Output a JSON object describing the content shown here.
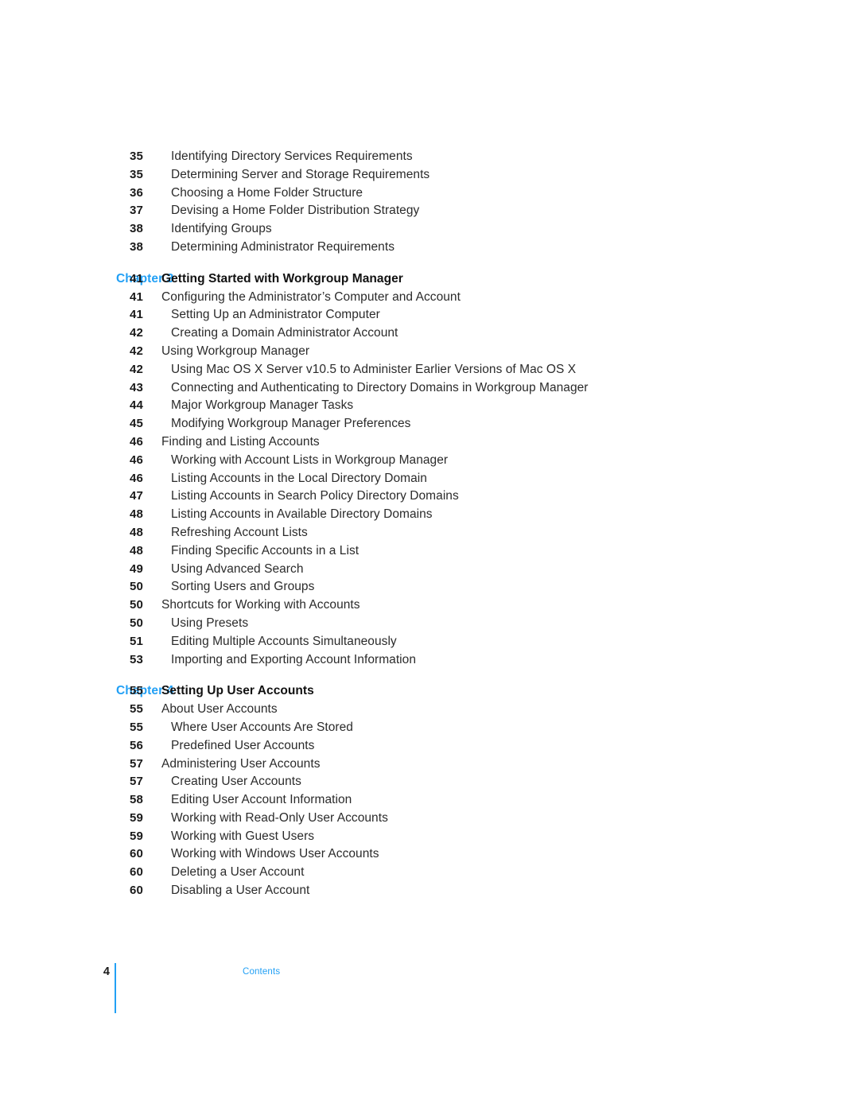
{
  "footer": {
    "page_number": "4",
    "label": "Contents",
    "rule_color": "#22a0f5"
  },
  "accent_color": "#22a0f5",
  "toc": {
    "rows": [
      {
        "chapter": "",
        "page": "35",
        "title": "Identifying Directory Services Requirements",
        "level": 2,
        "gap_before": false
      },
      {
        "chapter": "",
        "page": "35",
        "title": "Determining Server and Storage Requirements",
        "level": 2,
        "gap_before": false
      },
      {
        "chapter": "",
        "page": "36",
        "title": "Choosing a Home Folder Structure",
        "level": 2,
        "gap_before": false
      },
      {
        "chapter": "",
        "page": "37",
        "title": "Devising a Home Folder Distribution Strategy",
        "level": 2,
        "gap_before": false
      },
      {
        "chapter": "",
        "page": "38",
        "title": "Identifying Groups",
        "level": 2,
        "gap_before": false
      },
      {
        "chapter": "",
        "page": "38",
        "title": "Determining Administrator Requirements",
        "level": 2,
        "gap_before": false
      },
      {
        "chapter": "Chapter 3",
        "page": "41",
        "title": "Getting Started with Workgroup Manager",
        "level": 0,
        "gap_before": true
      },
      {
        "chapter": "",
        "page": "41",
        "title": "Configuring the Administrator’s Computer and Account",
        "level": 1,
        "gap_before": false
      },
      {
        "chapter": "",
        "page": "41",
        "title": "Setting Up an Administrator Computer",
        "level": 2,
        "gap_before": false
      },
      {
        "chapter": "",
        "page": "42",
        "title": "Creating a Domain Administrator Account",
        "level": 2,
        "gap_before": false
      },
      {
        "chapter": "",
        "page": "42",
        "title": "Using Workgroup Manager",
        "level": 1,
        "gap_before": false
      },
      {
        "chapter": "",
        "page": "42",
        "title": "Using Mac OS X Server v10.5 to Administer Earlier Versions of Mac OS X",
        "level": 2,
        "gap_before": false
      },
      {
        "chapter": "",
        "page": "43",
        "title": "Connecting and Authenticating to Directory Domains in Workgroup Manager",
        "level": 2,
        "gap_before": false
      },
      {
        "chapter": "",
        "page": "44",
        "title": "Major Workgroup Manager Tasks",
        "level": 2,
        "gap_before": false
      },
      {
        "chapter": "",
        "page": "45",
        "title": "Modifying Workgroup Manager Preferences",
        "level": 2,
        "gap_before": false
      },
      {
        "chapter": "",
        "page": "46",
        "title": "Finding and Listing Accounts",
        "level": 1,
        "gap_before": false
      },
      {
        "chapter": "",
        "page": "46",
        "title": "Working with Account Lists in Workgroup Manager",
        "level": 2,
        "gap_before": false
      },
      {
        "chapter": "",
        "page": "46",
        "title": "Listing Accounts in the Local Directory Domain",
        "level": 2,
        "gap_before": false
      },
      {
        "chapter": "",
        "page": "47",
        "title": "Listing Accounts in Search Policy Directory Domains",
        "level": 2,
        "gap_before": false
      },
      {
        "chapter": "",
        "page": "48",
        "title": "Listing Accounts in Available Directory Domains",
        "level": 2,
        "gap_before": false
      },
      {
        "chapter": "",
        "page": "48",
        "title": "Refreshing Account Lists",
        "level": 2,
        "gap_before": false
      },
      {
        "chapter": "",
        "page": "48",
        "title": "Finding Specific Accounts in a List",
        "level": 2,
        "gap_before": false
      },
      {
        "chapter": "",
        "page": "49",
        "title": "Using Advanced Search",
        "level": 2,
        "gap_before": false
      },
      {
        "chapter": "",
        "page": "50",
        "title": "Sorting Users and Groups",
        "level": 2,
        "gap_before": false
      },
      {
        "chapter": "",
        "page": "50",
        "title": "Shortcuts for Working with Accounts",
        "level": 1,
        "gap_before": false
      },
      {
        "chapter": "",
        "page": "50",
        "title": "Using Presets",
        "level": 2,
        "gap_before": false
      },
      {
        "chapter": "",
        "page": "51",
        "title": "Editing Multiple Accounts Simultaneously",
        "level": 2,
        "gap_before": false
      },
      {
        "chapter": "",
        "page": "53",
        "title": "Importing and Exporting Account Information",
        "level": 2,
        "gap_before": false
      },
      {
        "chapter": "Chapter 4",
        "page": "55",
        "title": "Setting Up User Accounts",
        "level": 0,
        "gap_before": true
      },
      {
        "chapter": "",
        "page": "55",
        "title": "About User Accounts",
        "level": 1,
        "gap_before": false
      },
      {
        "chapter": "",
        "page": "55",
        "title": "Where User Accounts Are Stored",
        "level": 2,
        "gap_before": false
      },
      {
        "chapter": "",
        "page": "56",
        "title": "Predefined User Accounts",
        "level": 2,
        "gap_before": false
      },
      {
        "chapter": "",
        "page": "57",
        "title": "Administering User Accounts",
        "level": 1,
        "gap_before": false
      },
      {
        "chapter": "",
        "page": "57",
        "title": "Creating User Accounts",
        "level": 2,
        "gap_before": false
      },
      {
        "chapter": "",
        "page": "58",
        "title": "Editing User Account Information",
        "level": 2,
        "gap_before": false
      },
      {
        "chapter": "",
        "page": "59",
        "title": "Working with Read-Only User Accounts",
        "level": 2,
        "gap_before": false
      },
      {
        "chapter": "",
        "page": "59",
        "title": "Working with Guest Users",
        "level": 2,
        "gap_before": false
      },
      {
        "chapter": "",
        "page": "60",
        "title": "Working with Windows User Accounts",
        "level": 2,
        "gap_before": false
      },
      {
        "chapter": "",
        "page": "60",
        "title": "Deleting a User Account",
        "level": 2,
        "gap_before": false
      },
      {
        "chapter": "",
        "page": "60",
        "title": "Disabling a User Account",
        "level": 2,
        "gap_before": false
      }
    ]
  }
}
